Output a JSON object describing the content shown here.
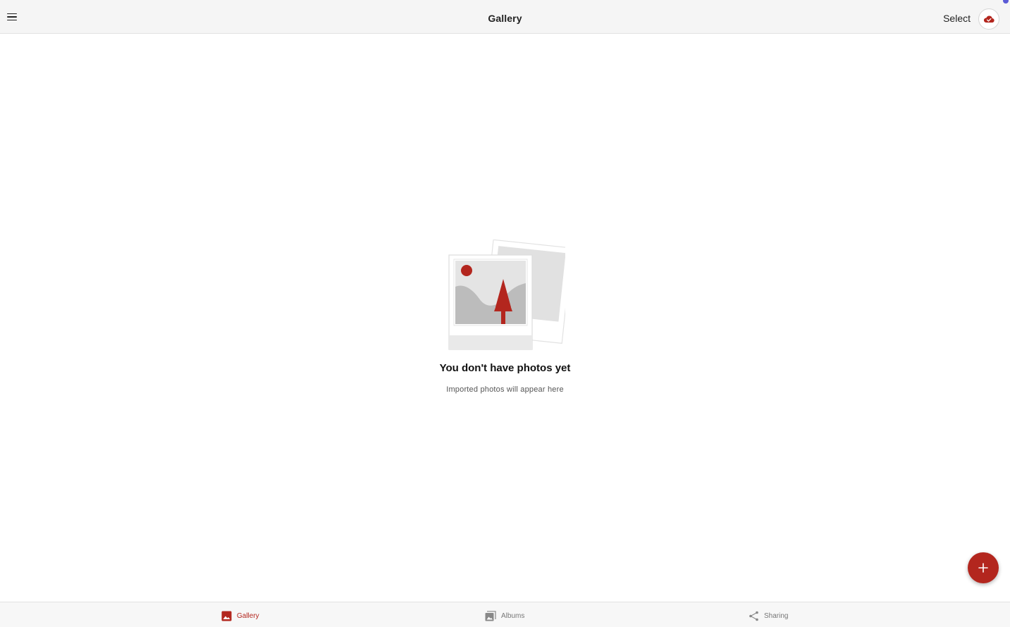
{
  "header": {
    "title": "Gallery",
    "select_label": "Select"
  },
  "empty_state": {
    "title": "You don't have photos yet",
    "subtitle": "Imported photos will  appear here"
  },
  "bottom_nav": {
    "items": [
      {
        "label": "Gallery",
        "icon": "photo-icon",
        "active": true
      },
      {
        "label": "Albums",
        "icon": "albums-icon",
        "active": false
      },
      {
        "label": "Sharing",
        "icon": "share-icon",
        "active": false
      }
    ]
  },
  "colors": {
    "accent": "#b3261e",
    "notification_dot": "#5b5bd6"
  }
}
